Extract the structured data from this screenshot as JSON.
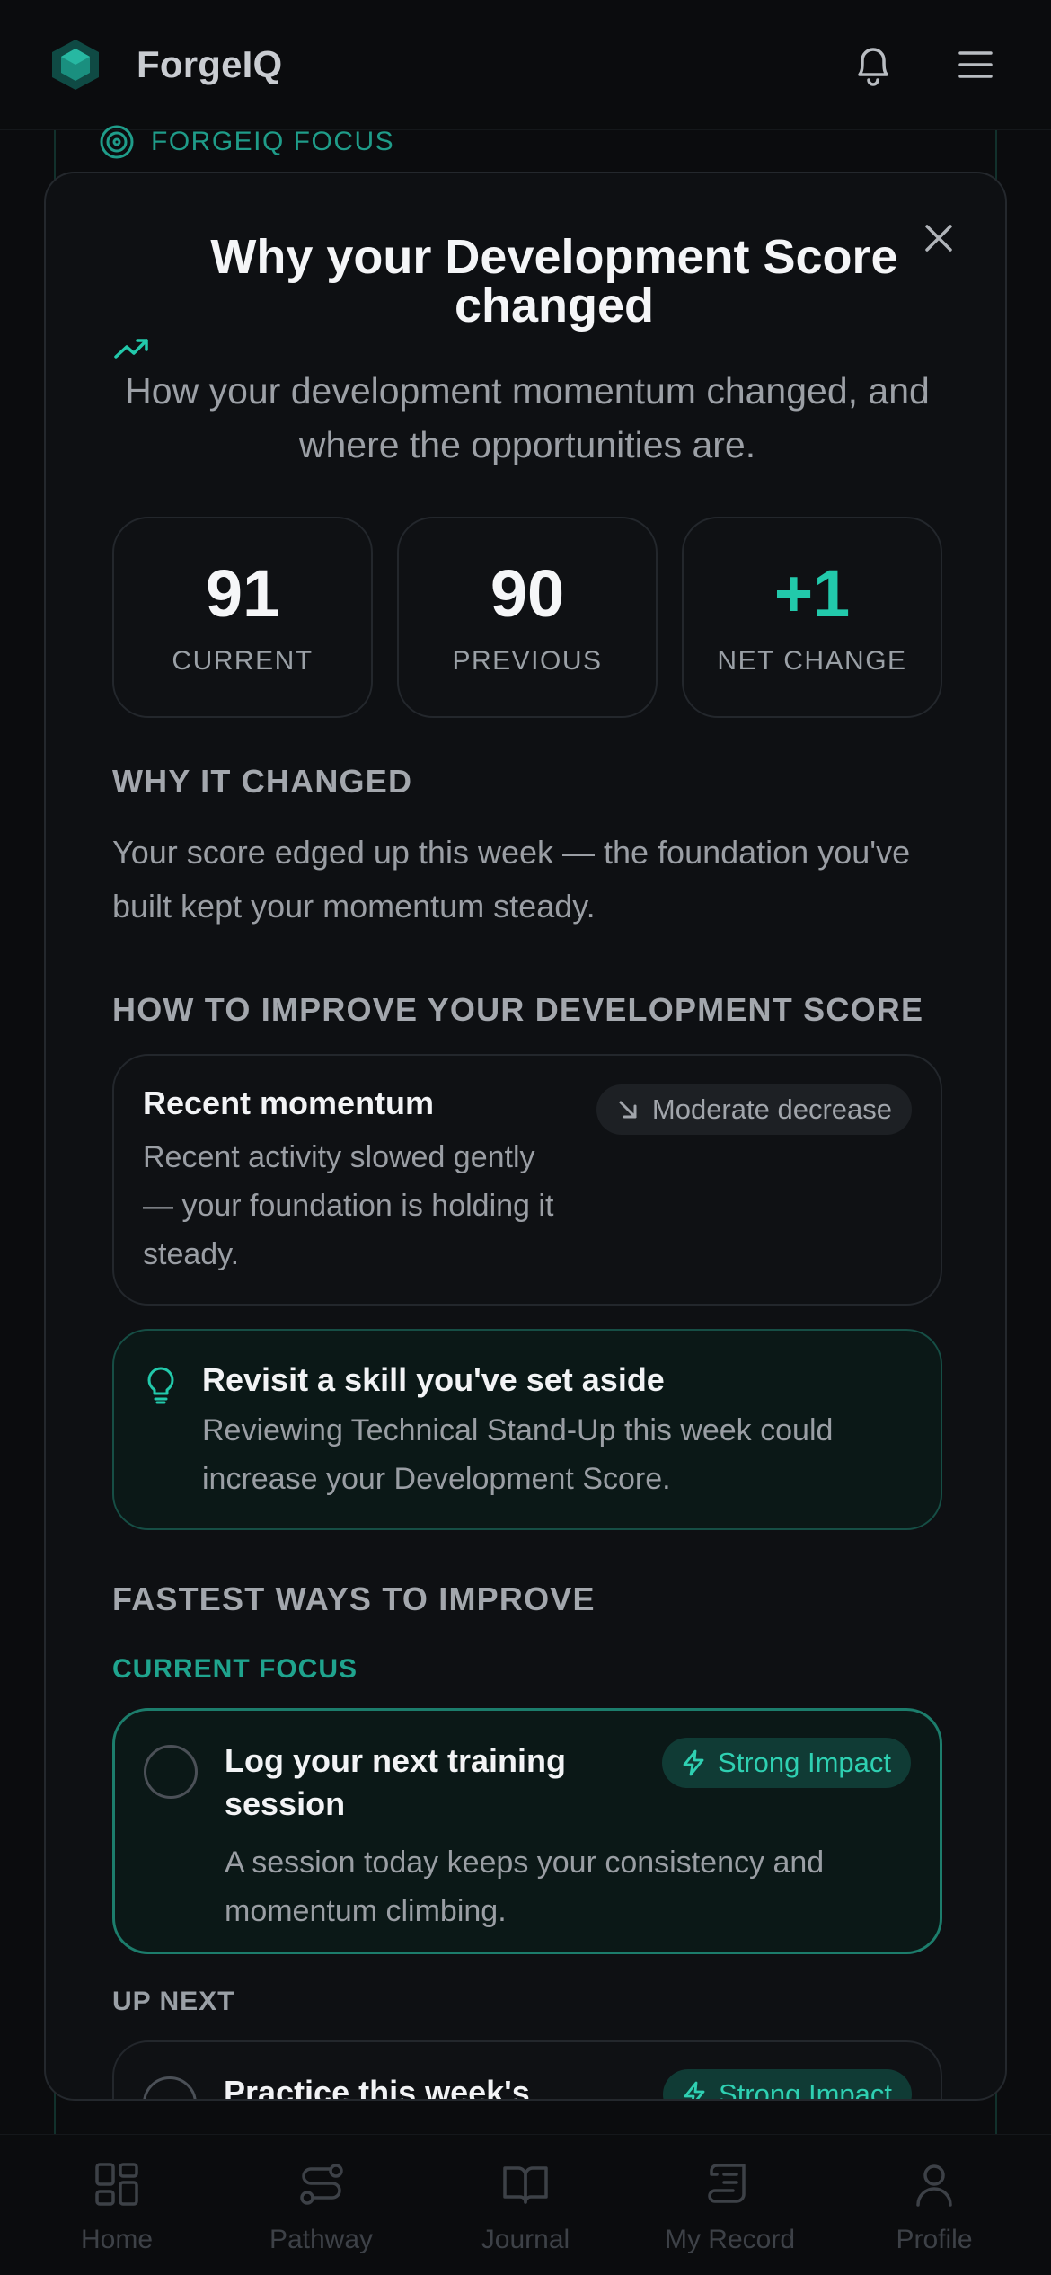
{
  "header": {
    "brand": "ForgeIQ"
  },
  "background": {
    "focus_label": "FORGEIQ FOCUS"
  },
  "modal": {
    "title": "Why your Development Score changed",
    "subtitle": "How your development momentum changed, and where the opportunities are.",
    "stats": [
      {
        "value": "91",
        "label": "CURRENT"
      },
      {
        "value": "90",
        "label": "PREVIOUS"
      },
      {
        "value": "+1",
        "label": "NET CHANGE"
      }
    ],
    "why_heading": "WHY IT CHANGED",
    "why_text": "Your score edged up this week — the foundation you've built kept your momentum steady.",
    "improve_heading": "HOW TO IMPROVE YOUR DEVELOPMENT SCORE",
    "momentum": {
      "title": "Recent momentum",
      "description": "Recent activity slowed gently — your foundation is holding it steady.",
      "badge": "Moderate decrease"
    },
    "tip": {
      "title": "Revisit a skill you've set aside",
      "description": "Reviewing Technical Stand-Up this week could increase your Development Score."
    },
    "fastest_heading": "FASTEST WAYS TO IMPROVE",
    "current_focus_label": "CURRENT FOCUS",
    "focus_action": {
      "title": "Log your next training session",
      "description": "A session today keeps your consistency and momentum climbing.",
      "badge": "Strong Impact"
    },
    "up_next_label": "UP NEXT",
    "next_action": {
      "title": "Practice this week's",
      "badge": "Strong Impact"
    }
  },
  "nav": [
    {
      "label": "Home",
      "icon": "grid-icon"
    },
    {
      "label": "Pathway",
      "icon": "route-icon"
    },
    {
      "label": "Journal",
      "icon": "book-icon"
    },
    {
      "label": "My Record",
      "icon": "scroll-icon"
    },
    {
      "label": "Profile",
      "icon": "user-icon"
    }
  ],
  "colors": {
    "accent": "#22c9ab",
    "background": "#0b0c0e",
    "modal": "#0e1013"
  }
}
